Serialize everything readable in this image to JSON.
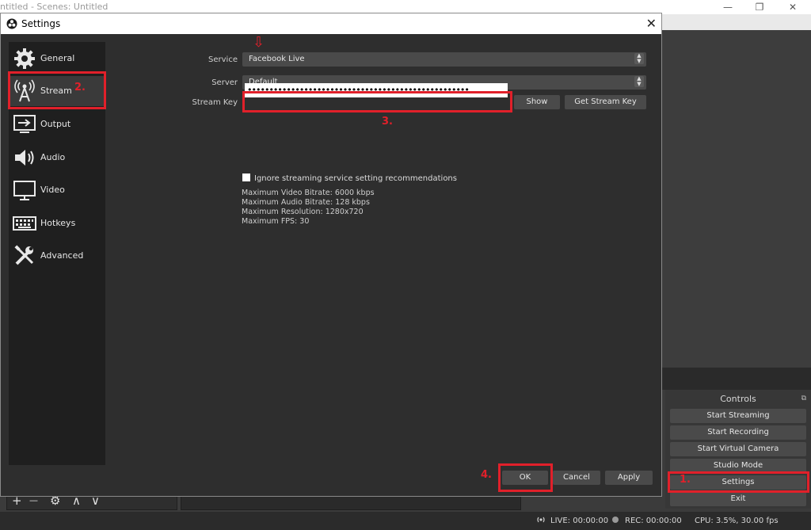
{
  "main_window": {
    "title": "ntitled - Scenes: Untitled",
    "minimize_glyph": "—",
    "restore_glyph": "❐",
    "close_glyph": "✕"
  },
  "dialog": {
    "title": "Settings",
    "close_glyph": "✕"
  },
  "sidebar": {
    "items": [
      {
        "label": "General",
        "icon": "gear-icon"
      },
      {
        "label": "Stream",
        "icon": "broadcast-antenna-icon"
      },
      {
        "label": "Output",
        "icon": "output-monitor-icon"
      },
      {
        "label": "Audio",
        "icon": "speaker-icon"
      },
      {
        "label": "Video",
        "icon": "monitor-icon"
      },
      {
        "label": "Hotkeys",
        "icon": "keyboard-icon"
      },
      {
        "label": "Advanced",
        "icon": "tools-icon"
      }
    ]
  },
  "stream": {
    "service_label": "Service",
    "service_value": "Facebook Live",
    "server_label": "Server",
    "server_value": "Default",
    "key_label": "Stream Key",
    "key_value": "•••••••••••••••••••••••••••••••••••••••••••••••••••",
    "show_button": "Show",
    "get_key_button": "Get Stream Key",
    "ignore_checkbox_label": "Ignore streaming service setting recommendations",
    "ignore_checked": false,
    "limits": [
      "Maximum Video Bitrate: 6000 kbps",
      "Maximum Audio Bitrate: 128 kbps",
      "Maximum Resolution: 1280x720",
      "Maximum FPS: 30"
    ]
  },
  "dialog_buttons": {
    "ok": "OK",
    "cancel": "Cancel",
    "apply": "Apply"
  },
  "annotations": {
    "step1": "1.",
    "step2": "2.",
    "step3": "3.",
    "step4": "4.",
    "arrow": "⇩",
    "color": "#e1202a"
  },
  "controls": {
    "header": "Controls",
    "float_glyph": "⧉",
    "buttons": [
      "Start Streaming",
      "Start Recording",
      "Start Virtual Camera",
      "Studio Mode",
      "Settings",
      "Exit"
    ]
  },
  "source_toolbar": {
    "add": "+",
    "remove": "—",
    "settings": "⚙",
    "up": "∧",
    "down": "∨"
  },
  "status": {
    "live": "LIVE: 00:00:00",
    "rec": "REC: 00:00:00",
    "cpu": "CPU: 3.5%, 30.00 fps"
  }
}
